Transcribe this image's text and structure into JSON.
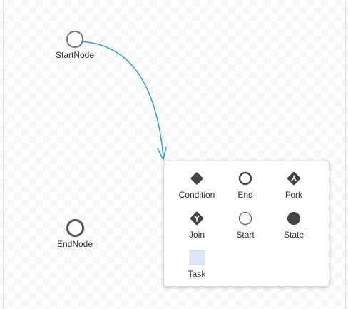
{
  "canvas": {
    "nodes": {
      "start": {
        "label": "StartNode"
      },
      "end": {
        "label": "EndNode"
      }
    },
    "connector_color": "#29a3dd"
  },
  "palette": {
    "items": [
      {
        "label": "Condition",
        "icon": "condition-diamond-icon"
      },
      {
        "label": "End",
        "icon": "end-circle-icon"
      },
      {
        "label": "Fork",
        "icon": "fork-icon"
      },
      {
        "label": "Join",
        "icon": "join-icon"
      },
      {
        "label": "Start",
        "icon": "start-circle-icon"
      },
      {
        "label": "State",
        "icon": "state-filled-circle-icon"
      },
      {
        "label": "Task",
        "icon": "task-square-icon"
      }
    ]
  }
}
